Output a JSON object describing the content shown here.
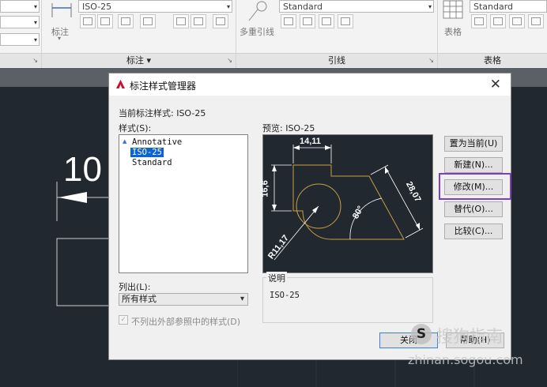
{
  "ribbon": {
    "dim_combo": "ISO-25",
    "dim_panel_label": "标注",
    "dim_big_label": "标注",
    "leader_combo": "Standard",
    "leader_btn_label": "多重引线",
    "leader_panel_label": "引线",
    "table_combo": "Standard",
    "table_btn_label": "表格",
    "table_panel_label": "表格",
    "dropdown_glyph": "▾",
    "corner_glyph": "↘"
  },
  "canvas": {
    "big_number": "10"
  },
  "dialog": {
    "title": "标注样式管理器",
    "close_glyph": "✕",
    "current_style_label": "当前标注样式: ISO-25",
    "styles_label": "样式(S):",
    "styles": [
      "Annotative",
      "ISO-25",
      "Standard"
    ],
    "selected_style": "ISO-25",
    "annotative_icon": "▲",
    "list_label": "列出(L):",
    "list_value": "所有样式",
    "exclude_xref_label": "不列出外部参照中的样式(D)",
    "preview_label": "预览: ISO-25",
    "preview_dims": {
      "top": "14,11",
      "left": "16,6",
      "right": "28,07",
      "angle": "80°",
      "radius": "R11,17"
    },
    "description_label": "说明",
    "description_text": "ISO-25",
    "buttons": {
      "set_current": "置为当前(U)",
      "new": "新建(N)...",
      "modify": "修改(M)...",
      "override": "替代(O)...",
      "compare": "比较(C)..."
    },
    "close_button": "关闭",
    "help_button": "帮助(H)"
  },
  "watermark": {
    "brand": "搜狗指南",
    "url": "zhinan.sogou.com",
    "logo_letter": "S"
  },
  "colors": {
    "highlight": "#7a3fc5",
    "selection": "#0a64d8",
    "preview_bg": "#212830",
    "geometry": "#c8a040"
  }
}
